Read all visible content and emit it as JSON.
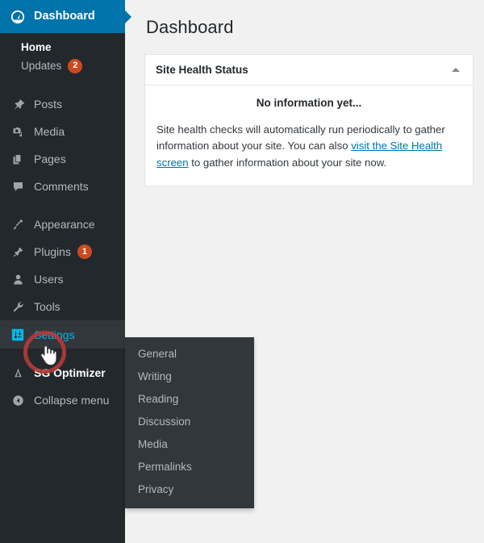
{
  "sidebar": {
    "dashboard": {
      "label": "Dashboard",
      "icon": "dashboard-speedometer-icon"
    },
    "dashboard_submenu": [
      {
        "label": "Home",
        "selected": true
      },
      {
        "label": "Updates",
        "selected": false,
        "badge": "2"
      }
    ],
    "groups": [
      [
        {
          "label": "Posts",
          "icon": "pin-icon"
        },
        {
          "label": "Media",
          "icon": "media-camera-icon"
        },
        {
          "label": "Pages",
          "icon": "pages-icon"
        },
        {
          "label": "Comments",
          "icon": "comment-bubble-icon"
        }
      ],
      [
        {
          "label": "Appearance",
          "icon": "paintbrush-icon"
        },
        {
          "label": "Plugins",
          "icon": "plug-icon",
          "badge": "1"
        },
        {
          "label": "Users",
          "icon": "user-icon"
        },
        {
          "label": "Tools",
          "icon": "wrench-icon"
        },
        {
          "label": "Settings",
          "icon": "settings-sliders-icon",
          "state": "active"
        }
      ],
      [
        {
          "label": "SG Optimizer",
          "icon": "sg-optimizer-icon"
        },
        {
          "label": "Collapse menu",
          "icon": "collapse-arrow-icon"
        }
      ]
    ]
  },
  "settings_flyout": {
    "items": [
      {
        "label": "General"
      },
      {
        "label": "Writing"
      },
      {
        "label": "Reading"
      },
      {
        "label": "Discussion"
      },
      {
        "label": "Media"
      },
      {
        "label": "Permalinks"
      },
      {
        "label": "Privacy"
      }
    ]
  },
  "main": {
    "page_title": "Dashboard",
    "site_health": {
      "panel_title": "Site Health Status",
      "toggle_icon": "chevron-up-icon",
      "no_info": "No information yet...",
      "desc_part1": "Site health checks will automatically run periodically to gather information about your site. You can also ",
      "link_text": "visit the Site Health screen",
      "desc_part2": " to gather information about your site now."
    }
  },
  "annotation": {
    "highlight_color": "#b93a3a",
    "target": "Settings",
    "cursor": "pointing-hand-cursor"
  }
}
